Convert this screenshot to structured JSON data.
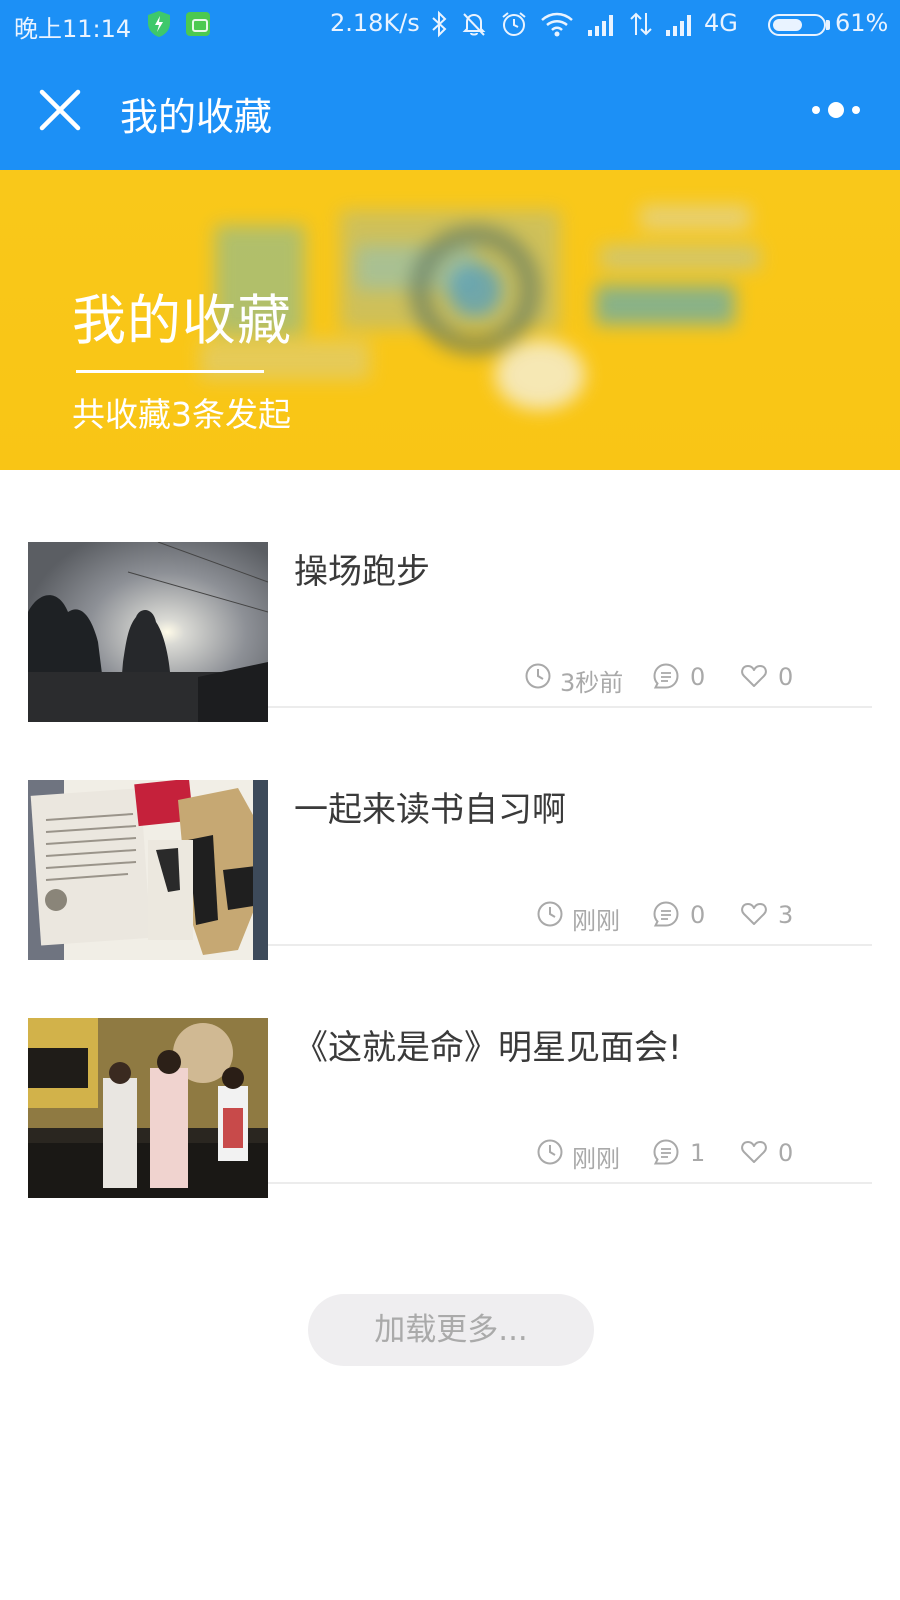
{
  "status_bar": {
    "time": "晚上11:14",
    "speed": "2.18K/s",
    "network": "4G",
    "battery_pct": "61%",
    "battery_level": 0.61,
    "icons": [
      "shield-icon",
      "app-icon",
      "bluetooth-icon",
      "mute-icon",
      "alarm-icon",
      "wifi-icon",
      "signal-icon",
      "data-arrows-icon",
      "signal-icon-2",
      "battery-icon"
    ]
  },
  "nav": {
    "title": "我的收藏",
    "close_icon": "close-icon",
    "more_icon": "more-icon",
    "bg_color": "#1c90f6"
  },
  "banner": {
    "title": "我的收藏",
    "subtitle": "共收藏3条发起",
    "bg_color": "#f9c81a"
  },
  "items": [
    {
      "title": "操场跑步",
      "time": "3秒前",
      "comments": "0",
      "likes": "0",
      "thumb": "playground-photo"
    },
    {
      "title": "一起来读书自习啊",
      "time": "刚刚",
      "comments": "0",
      "likes": "3",
      "thumb": "book-photo"
    },
    {
      "title": "《这就是命》明星见面会!",
      "time": "刚刚",
      "comments": "1",
      "likes": "0",
      "thumb": "stage-photo"
    }
  ],
  "load_more": "加载更多..."
}
